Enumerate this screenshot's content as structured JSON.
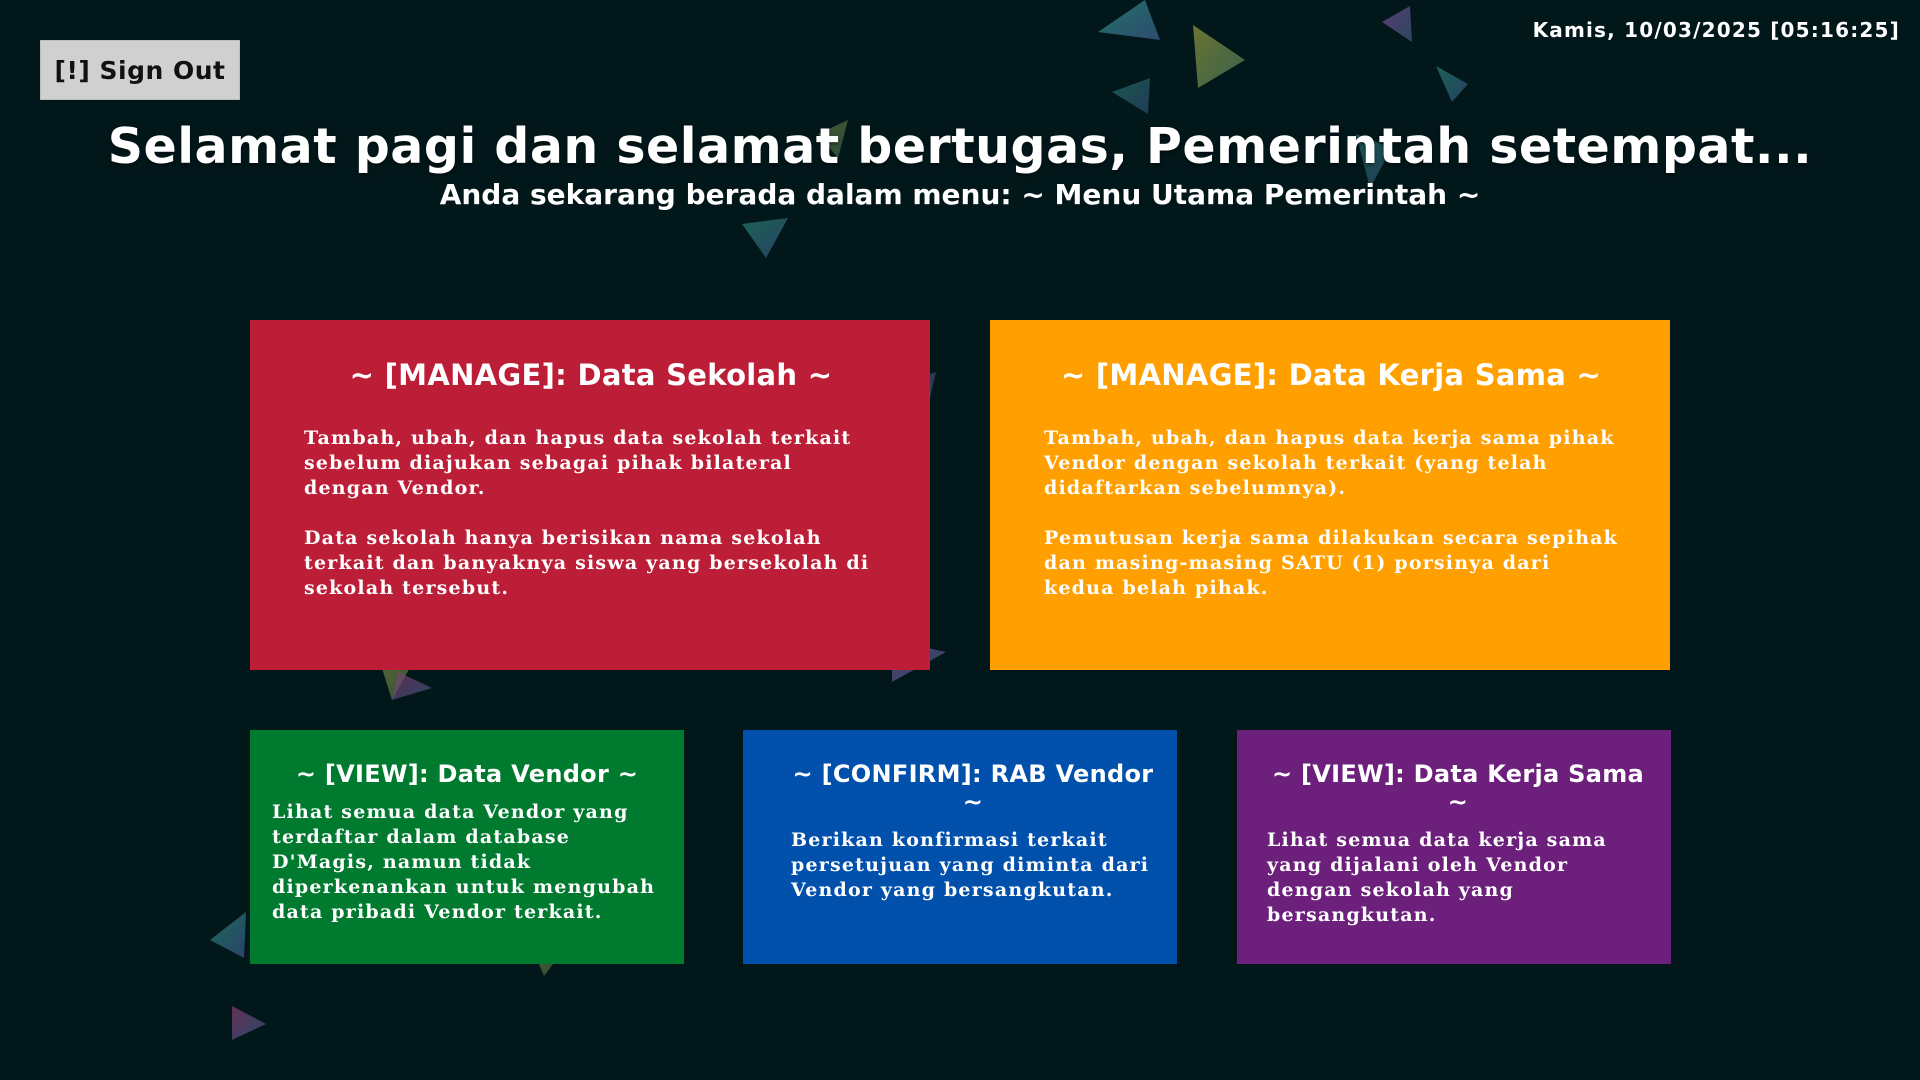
{
  "header": {
    "signout_label": "[!] Sign Out",
    "datetime": "Kamis, 10/03/2025 [05:16:25]",
    "title": "Selamat pagi dan selamat bertugas, Pemerintah setempat...",
    "subtitle": "Anda sekarang berada dalam menu: ~ Menu Utama Pemerintah ~"
  },
  "cards": {
    "sekolah": {
      "title": "~ [MANAGE]: Data Sekolah ~",
      "para1": "Tambah, ubah, dan hapus data sekolah terkait sebelum diajukan sebagai pihak bilateral dengan Vendor.",
      "para2": "Data sekolah hanya berisikan nama sekolah terkait dan banyaknya siswa yang bersekolah di sekolah tersebut.",
      "color": "#bd1e37"
    },
    "kerjasama": {
      "title": "~ [MANAGE]: Data Kerja Sama ~",
      "para1": "Tambah, ubah, dan hapus data kerja sama pihak Vendor dengan sekolah terkait (yang telah didaftarkan sebelumnya).",
      "para2": "Pemutusan kerja sama dilakukan secara sepihak dan masing-masing SATU (1) porsinya dari kedua belah pihak.",
      "color": "#ffa000"
    },
    "vendor": {
      "title": "~ [VIEW]: Data Vendor ~",
      "body": "Lihat semua data Vendor yang terdaftar dalam database D'Magis, namun tidak diperkenankan untuk mengubah data pribadi Vendor terkait.",
      "color": "#007a2f"
    },
    "rab": {
      "title": "~ [CONFIRM]: RAB Vendor ~",
      "body": "Berikan konfirmasi terkait persetujuan yang diminta dari Vendor yang bersangkutan.",
      "color": "#0050ac"
    },
    "view_kerjasama": {
      "title": "~ [VIEW]: Data Kerja Sama ~",
      "body": "Lihat semua data kerja sama yang dijalani oleh Vendor dengan sekolah yang bersangkutan.",
      "color": "#6c207b"
    }
  },
  "background": {
    "color": "#02171a",
    "decoration": "floating-translucent-triangles"
  }
}
